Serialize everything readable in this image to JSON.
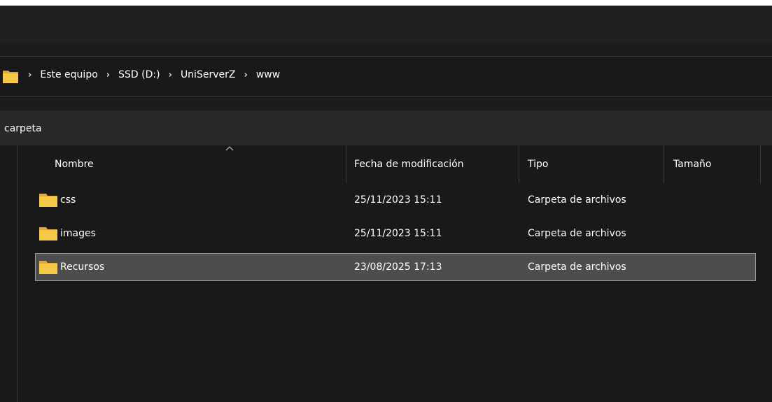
{
  "address_bar": {
    "breadcrumbs": [
      {
        "label": "Este equipo"
      },
      {
        "label": "SSD (D:)"
      },
      {
        "label": "UniServerZ"
      },
      {
        "label": "www"
      }
    ],
    "separator": "›"
  },
  "toolbar": {
    "label": "carpeta"
  },
  "columns": {
    "name": "Nombre",
    "modified": "Fecha de modificación",
    "type": "Tipo",
    "size": "Tamaño"
  },
  "files": [
    {
      "name": "css",
      "modified": "25/11/2023 15:11",
      "type": "Carpeta de archivos",
      "size": "",
      "selected": false
    },
    {
      "name": "images",
      "modified": "25/11/2023 15:11",
      "type": "Carpeta de archivos",
      "size": "",
      "selected": false
    },
    {
      "name": "Recursos",
      "modified": "23/08/2025 17:13",
      "type": "Carpeta de archivos",
      "size": "",
      "selected": true
    }
  ],
  "colors": {
    "folder": "#f7c948",
    "folder_dark": "#e0a82e",
    "selection": "#4d4d4d"
  }
}
